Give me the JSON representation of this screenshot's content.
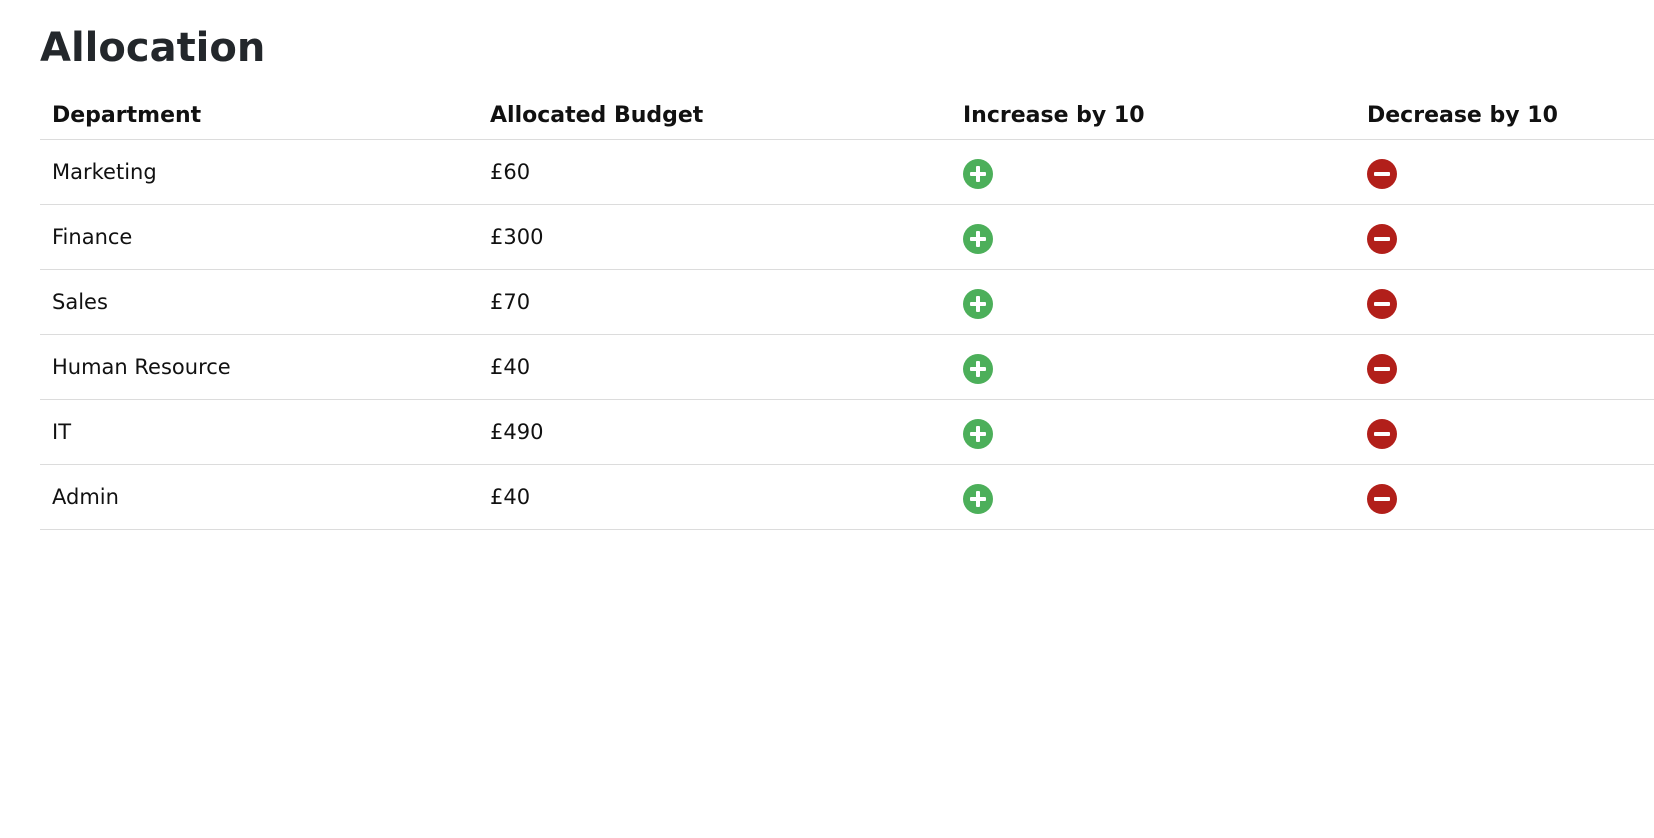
{
  "page": {
    "title": "Allocation"
  },
  "table": {
    "headers": [
      "Department",
      "Allocated Budget",
      "Increase by 10",
      "Decrease by 10"
    ],
    "rows": [
      {
        "department": "Marketing",
        "budget": "£60"
      },
      {
        "department": "Finance",
        "budget": "£300"
      },
      {
        "department": "Sales",
        "budget": "£70"
      },
      {
        "department": "Human Resource",
        "budget": "£40"
      },
      {
        "department": "IT",
        "budget": "£490"
      },
      {
        "department": "Admin",
        "budget": "£40"
      }
    ]
  },
  "icons": {
    "increase": "plus-circle-icon",
    "decrease": "minus-circle-icon"
  },
  "colors": {
    "increase": "#4caf5a",
    "decrease": "#b21f1a",
    "row_border": "#dcdcdc",
    "title": "#23272b"
  }
}
